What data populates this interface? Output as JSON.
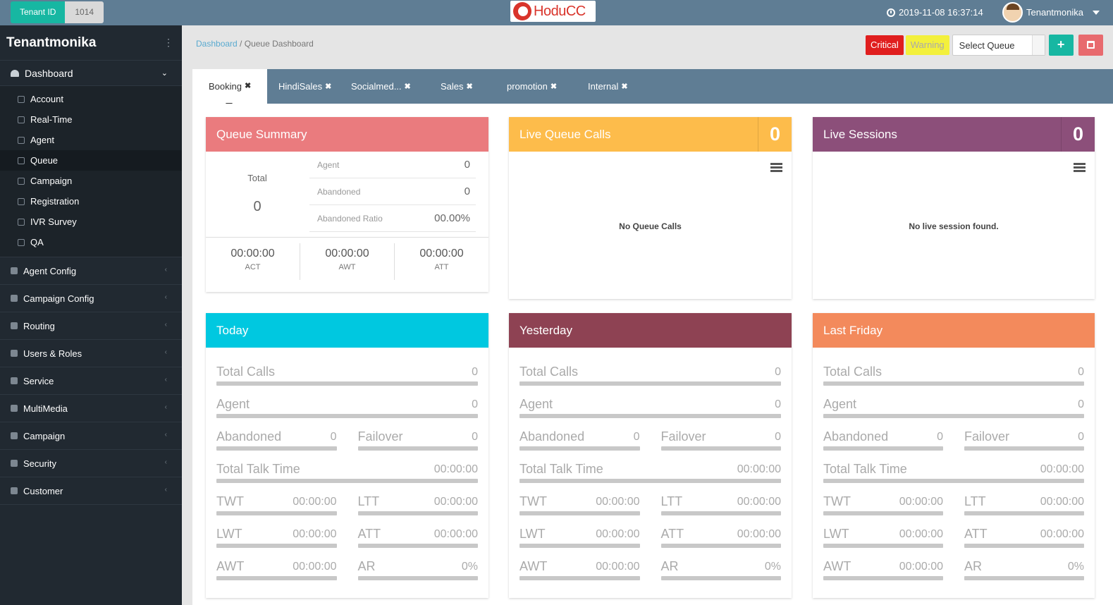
{
  "topbar": {
    "tenant_label": "Tenant ID",
    "tenant_value": "1014",
    "logo_text": "HoduCC",
    "datetime": "2019-11-08 16:37:14",
    "username": "Tenantmonika"
  },
  "sidebar": {
    "title": "Tenantmonika",
    "menu_dots": "⋮",
    "dashboard_label": "Dashboard",
    "sub_items": [
      {
        "label": "Account"
      },
      {
        "label": "Real-Time"
      },
      {
        "label": "Agent"
      },
      {
        "label": "Queue"
      },
      {
        "label": "Campaign"
      },
      {
        "label": "Registration"
      },
      {
        "label": "IVR Survey"
      },
      {
        "label": "QA"
      }
    ],
    "groups": [
      {
        "label": "Agent Config"
      },
      {
        "label": "Campaign Config"
      },
      {
        "label": "Routing"
      },
      {
        "label": "Users & Roles"
      },
      {
        "label": "Service"
      },
      {
        "label": "MultiMedia"
      },
      {
        "label": "Campaign"
      },
      {
        "label": "Security"
      },
      {
        "label": "Customer"
      }
    ]
  },
  "breadcrumb": {
    "root": "Dashboard",
    "sep": " / ",
    "current": "Queue Dashboard"
  },
  "actions": {
    "critical": "Critical",
    "warning": "Warning",
    "select_queue": "Select Queue",
    "add": "+"
  },
  "tabs": [
    {
      "label": "Booking"
    },
    {
      "label": "HindiSales"
    },
    {
      "label": "Socialmed..."
    },
    {
      "label": "Sales"
    },
    {
      "label": "promotion"
    },
    {
      "label": "Internal"
    }
  ],
  "queue_summary": {
    "title": "Queue Summary",
    "total_label": "Total",
    "total_value": "0",
    "rows": [
      {
        "label": "Agent",
        "value": "0"
      },
      {
        "label": "Abandoned",
        "value": "0"
      },
      {
        "label": "Abandoned Ratio",
        "value": "00.00%"
      }
    ],
    "times": [
      {
        "value": "00:00:00",
        "label": "ACT"
      },
      {
        "value": "00:00:00",
        "label": "AWT"
      },
      {
        "value": "00:00:00",
        "label": "ATT"
      }
    ]
  },
  "live_queue": {
    "title": "Live Queue Calls",
    "count": "0",
    "empty": "No Queue Calls"
  },
  "live_sessions": {
    "title": "Live Sessions",
    "count": "0",
    "empty": "No live session found."
  },
  "stats_labels": {
    "total_calls": "Total Calls",
    "agent": "Agent",
    "abandoned": "Abandoned",
    "failover": "Failover",
    "total_talk_time": "Total Talk Time",
    "twt": "TWT",
    "ltt": "LTT",
    "lwt": "LWT",
    "att": "ATT",
    "awt": "AWT",
    "ar": "AR"
  },
  "stats": [
    {
      "title": "Today",
      "color": "#00c8e0",
      "total_calls": "0",
      "agent": "0",
      "abandoned": "0",
      "failover": "0",
      "total_talk_time": "00:00:00",
      "twt": "00:00:00",
      "ltt": "00:00:00",
      "lwt": "00:00:00",
      "att": "00:00:00",
      "awt": "00:00:00",
      "ar": "0%"
    },
    {
      "title": "Yesterday",
      "color": "#8e4253",
      "total_calls": "0",
      "agent": "0",
      "abandoned": "0",
      "failover": "0",
      "total_talk_time": "00:00:00",
      "twt": "00:00:00",
      "ltt": "00:00:00",
      "lwt": "00:00:00",
      "att": "00:00:00",
      "awt": "00:00:00",
      "ar": "0%"
    },
    {
      "title": "Last Friday",
      "color": "#f38a5c",
      "total_calls": "0",
      "agent": "0",
      "abandoned": "0",
      "failover": "0",
      "total_talk_time": "00:00:00",
      "twt": "00:00:00",
      "ltt": "00:00:00",
      "lwt": "00:00:00",
      "att": "00:00:00",
      "awt": "00:00:00",
      "ar": "0%"
    }
  ],
  "colors": {
    "topbar": "#5f7d94",
    "sidebar": "#212931",
    "queue_summary": "#ea7b7e",
    "live_queue": "#fdbc4b",
    "live_sessions": "#8c4f7a",
    "accent": "#17b7a2"
  }
}
